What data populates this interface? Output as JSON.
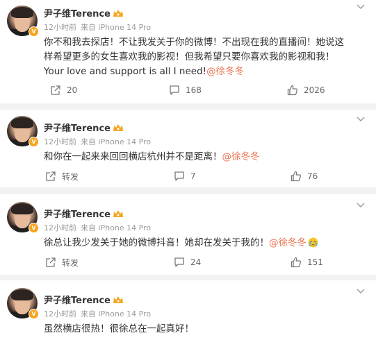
{
  "posts": [
    {
      "username": "尹子维Terence",
      "time": "12小时前",
      "source": "来自 iPhone 14 Pro",
      "text": "你不和我去探店！不让我发关于你的微博！不出现在我的直播间！她说这样希望更多的女生喜欢我的影视！但我希望只要你喜欢我的影视和我！Your love and support is all I need!",
      "mention": "@徐冬冬",
      "emoji": "",
      "repost": "20",
      "comments": "168",
      "likes": "2026"
    },
    {
      "username": "尹子维Terence",
      "time": "12小时前",
      "source": "来自 iPhone 14 Pro",
      "text": "和你在一起来来回回横店杭州并不是距离！",
      "mention": "@徐冬冬",
      "emoji": "",
      "repost": "转发",
      "comments": "7",
      "likes": "76"
    },
    {
      "username": "尹子维Terence",
      "time": "12小时前",
      "source": "来自 iPhone 14 Pro",
      "text": "徐总让我少发关于她的微博抖音！她却在发关于我的！",
      "mention": "@徐冬冬",
      "emoji": "crying-emoji",
      "repost": "转发",
      "comments": "24",
      "likes": "151"
    },
    {
      "username": "尹子维Terence",
      "time": "12小时前",
      "source": "来自 iPhone 14 Pro",
      "text": "虽然横店很热！很徐总在一起真好！",
      "mention": "",
      "emoji": ""
    }
  ],
  "colors": {
    "accent": "#eb7350",
    "verified": "#f7a51d",
    "meta": "#999999"
  }
}
